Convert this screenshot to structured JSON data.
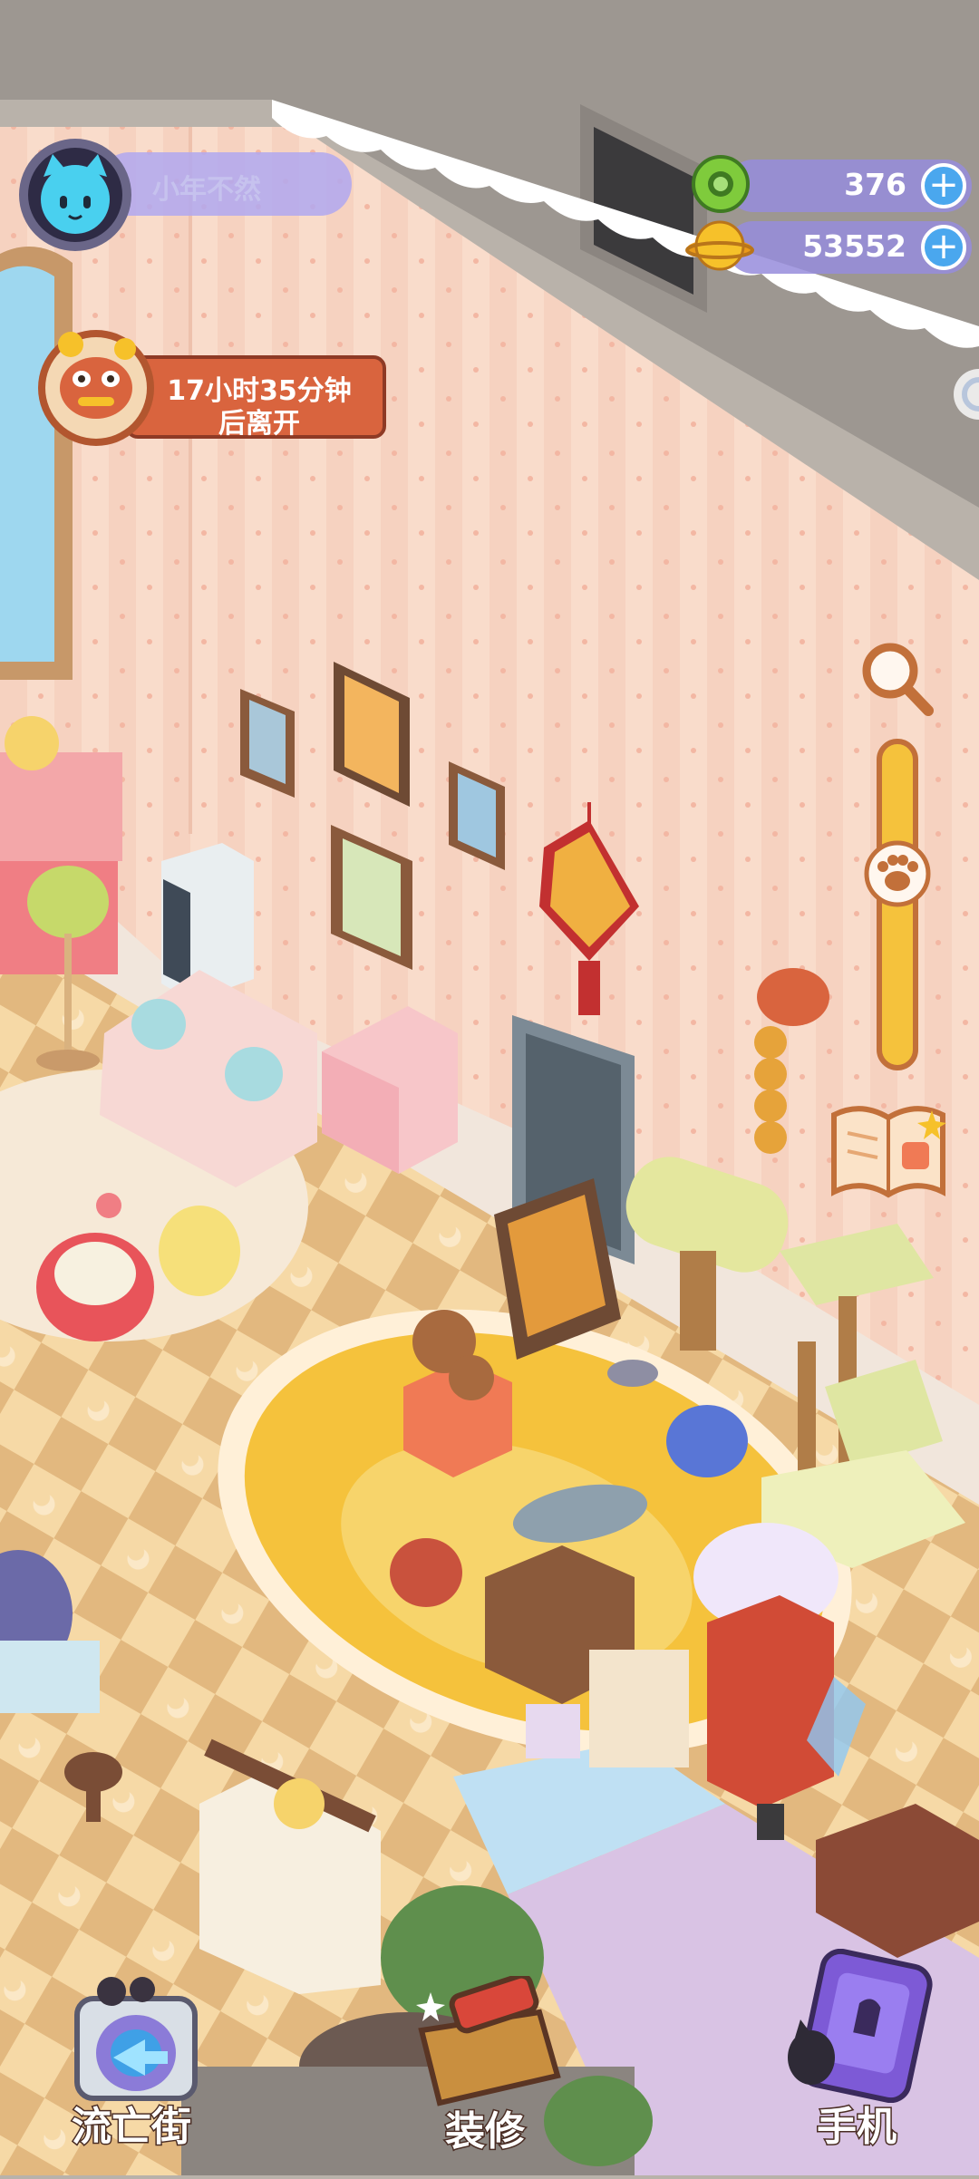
{
  "player": {
    "name": "小年不然",
    "avatar_icon": "blue-cat-avatar-icon"
  },
  "currencies": [
    {
      "icon": "green-leaf-coin-icon",
      "value": "376",
      "plus_label": "+"
    },
    {
      "icon": "gold-planet-coin-icon",
      "value": "53552",
      "plus_label": "+"
    }
  ],
  "visitor_timer": {
    "line1": "17小时35分钟",
    "line2": "后离开",
    "icon": "lion-dance-visitor-icon"
  },
  "zoom": {
    "search_icon": "magnifier-icon",
    "handle_icon": "paw-handle-icon",
    "level": 0.38
  },
  "guide": {
    "icon": "open-book-icon"
  },
  "bottom_nav": {
    "exile_street": "流亡街",
    "decorate": "装修",
    "phone": "手机"
  },
  "colors": {
    "wall": "#f9dccb",
    "floor_light": "#f6d9a6",
    "floor_dark": "#e2b87f",
    "rug": "#f5c23c",
    "accent_purple": "#9a8de0",
    "accent_blue": "#4aa7ee",
    "timer_orange": "#d9643e"
  }
}
